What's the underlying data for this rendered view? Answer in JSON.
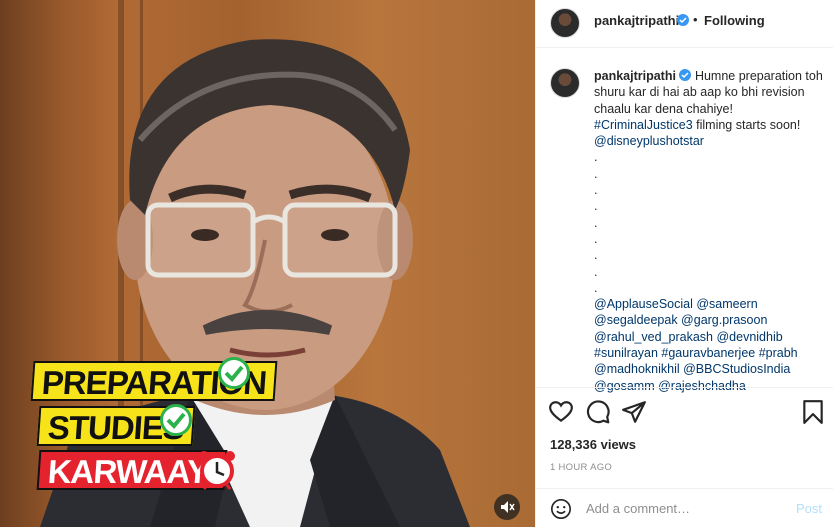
{
  "post": {
    "username": "pankajtripathi",
    "header_dot": "•",
    "follow_status": "Following",
    "caption": {
      "text": "Humne preparation toh shuru kar di hai ab aap ko bhi revision chaalu kar dena chahiye!",
      "hashtag": "#CriminalJustice3",
      "after_hashtag": " filming starts soon!",
      "mention": "@disneyplushotstar",
      "dots": [
        ".",
        ".",
        ".",
        ".",
        ".",
        ".",
        ".",
        ".",
        "."
      ],
      "tag_lines": [
        "@ApplauseSocial @sameern",
        "@segaldeepak @garg.prasoon",
        "@rahul_ved_prakash @devnidhib",
        "#sunilrayan #gauravbanerjee #prabh",
        "@madhoknikhil @BBCStudiosIndia",
        "@gosamm @rajeshchadha"
      ]
    },
    "views": "128,336 views",
    "time": "1 HOUR AGO",
    "comment_placeholder": "Add a comment…",
    "post_label": "Post"
  },
  "video": {
    "stamps": [
      "PREPARATION",
      "STUDIES",
      "KARWAAYI"
    ],
    "colors": {
      "stamp_yellow": "#f7e31a",
      "stamp_red": "#e5232e",
      "check_green": "#2bb24c"
    }
  },
  "icons": [
    "heart-icon",
    "comment-icon",
    "share-icon",
    "bookmark-icon",
    "emoji-icon",
    "verified-badge-icon",
    "mute-icon",
    "alarm-clock-icon",
    "checkmark-icon"
  ]
}
